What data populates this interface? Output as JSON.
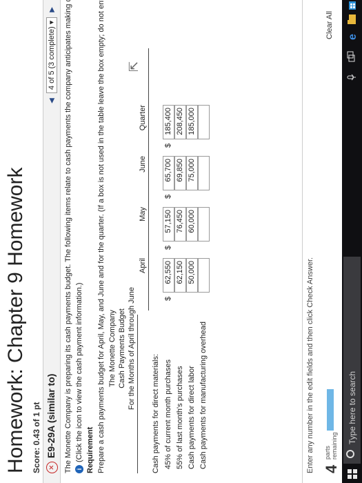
{
  "header": {
    "title": "Homework: Chapter 9 Homework",
    "score": "Score: 0.43 of 1 pt"
  },
  "exercise": {
    "name": "E9-29A (similar to)",
    "nav_text": "4 of 5 (3 complete)"
  },
  "problem": {
    "intro": "The Monette Company is preparing its cash payments budget. The following items relate to cash payments the company anticipates making during",
    "click_info": "(Click the icon to view the cash payment information.)",
    "requirement_label": "Requirement",
    "requirement_text": "Prepare a cash payments budget for April, May, and June and for the quarter. (If a box is not used in the table leave the box empty; do not enter a z"
  },
  "budget": {
    "company": "The Monette Company",
    "title": "Cash Payments Budget",
    "period": "For the Months of April through June",
    "columns": [
      "April",
      "May",
      "June",
      "Quarter"
    ],
    "section_label": "Cash payments for direct materials:",
    "rows": [
      {
        "label": "45% of current month purchases",
        "values": [
          "62,550",
          "57,150",
          "65,700",
          "185,400"
        ],
        "dollar": true
      },
      {
        "label": "55% of last month's purchases",
        "values": [
          "62,150",
          "76,450",
          "69,850",
          "208,450"
        ],
        "dollar": false
      },
      {
        "label": "Cash payments for direct labor",
        "values": [
          "50,000",
          "60,000",
          "75,000",
          "185,000"
        ],
        "dollar": false
      },
      {
        "label": "Cash payments for manufacturing overhead",
        "values": [
          "",
          "",
          "",
          ""
        ],
        "dollar": false
      }
    ]
  },
  "footer": {
    "instruction": "Enter any number in the edit fields and then click Check Answer.",
    "parts_count": "4",
    "parts_label_1": "parts",
    "parts_label_2": "remaining",
    "clear_all": "Clear All"
  },
  "taskbar": {
    "search_placeholder": "Type here to search"
  },
  "colors": {
    "accent": "#1e63b8",
    "nav_arrow": "#2a4a87",
    "progress": "#6fb7e6",
    "error": "#c62828"
  }
}
